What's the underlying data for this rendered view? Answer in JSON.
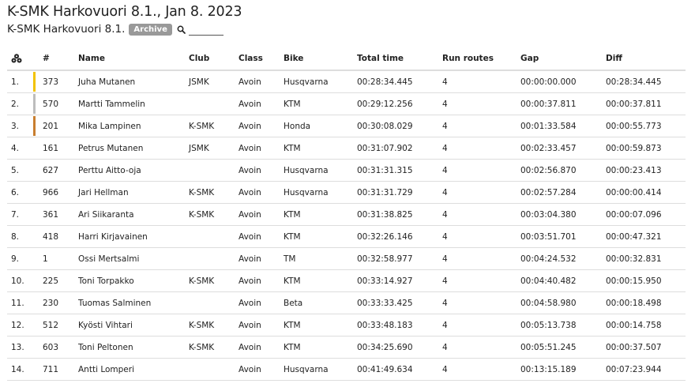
{
  "header": {
    "title": "K-SMK Harkovuori 8.1., Jan 8. 2023",
    "event_name": "K-SMK Harkovuori 8.1.",
    "badge": "Archive",
    "search_placeholder": ""
  },
  "colors": {
    "gold": "#f2c300",
    "silver": "#bdbdbd",
    "bronze": "#c87e2f",
    "badge_bg": "#999999",
    "row_border": "#dddddd"
  },
  "table": {
    "columns": {
      "num": "#",
      "name": "Name",
      "club": "Club",
      "class": "Class",
      "bike": "Bike",
      "total": "Total time",
      "runs": "Run routes",
      "gap": "Gap",
      "diff": "Diff"
    },
    "rows": [
      {
        "pos": "1.",
        "num": "373",
        "name": "Juha Mutanen",
        "club": "JSMK",
        "class": "Avoin",
        "bike": "Husqvarna",
        "total": "00:28:34.445",
        "runs": "4",
        "gap": "00:00:00.000",
        "diff": "00:28:34.445",
        "medal": "gold"
      },
      {
        "pos": "2.",
        "num": "570",
        "name": "Martti Tammelin",
        "club": "",
        "class": "Avoin",
        "bike": "KTM",
        "total": "00:29:12.256",
        "runs": "4",
        "gap": "00:00:37.811",
        "diff": "00:00:37.811",
        "medal": "silver"
      },
      {
        "pos": "3.",
        "num": "201",
        "name": "Mika Lampinen",
        "club": "K-SMK",
        "class": "Avoin",
        "bike": "Honda",
        "total": "00:30:08.029",
        "runs": "4",
        "gap": "00:01:33.584",
        "diff": "00:00:55.773",
        "medal": "bronze"
      },
      {
        "pos": "4.",
        "num": "161",
        "name": "Petrus Mutanen",
        "club": "JSMK",
        "class": "Avoin",
        "bike": "KTM",
        "total": "00:31:07.902",
        "runs": "4",
        "gap": "00:02:33.457",
        "diff": "00:00:59.873",
        "medal": ""
      },
      {
        "pos": "5.",
        "num": "627",
        "name": "Perttu Aitto-oja",
        "club": "",
        "class": "Avoin",
        "bike": "Husqvarna",
        "total": "00:31:31.315",
        "runs": "4",
        "gap": "00:02:56.870",
        "diff": "00:00:23.413",
        "medal": ""
      },
      {
        "pos": "6.",
        "num": "966",
        "name": "Jari Hellman",
        "club": "K-SMK",
        "class": "Avoin",
        "bike": "Husqvarna",
        "total": "00:31:31.729",
        "runs": "4",
        "gap": "00:02:57.284",
        "diff": "00:00:00.414",
        "medal": ""
      },
      {
        "pos": "7.",
        "num": "361",
        "name": "Ari Siikaranta",
        "club": "K-SMK",
        "class": "Avoin",
        "bike": "KTM",
        "total": "00:31:38.825",
        "runs": "4",
        "gap": "00:03:04.380",
        "diff": "00:00:07.096",
        "medal": ""
      },
      {
        "pos": "8.",
        "num": "418",
        "name": "Harri Kirjavainen",
        "club": "",
        "class": "Avoin",
        "bike": "KTM",
        "total": "00:32:26.146",
        "runs": "4",
        "gap": "00:03:51.701",
        "diff": "00:00:47.321",
        "medal": ""
      },
      {
        "pos": "9.",
        "num": "1",
        "name": "Ossi Mertsalmi",
        "club": "",
        "class": "Avoin",
        "bike": "TM",
        "total": "00:32:58.977",
        "runs": "4",
        "gap": "00:04:24.532",
        "diff": "00:00:32.831",
        "medal": ""
      },
      {
        "pos": "10.",
        "num": "225",
        "name": "Toni Torpakko",
        "club": "K-SMK",
        "class": "Avoin",
        "bike": "KTM",
        "total": "00:33:14.927",
        "runs": "4",
        "gap": "00:04:40.482",
        "diff": "00:00:15.950",
        "medal": ""
      },
      {
        "pos": "11.",
        "num": "230",
        "name": "Tuomas Salminen",
        "club": "",
        "class": "Avoin",
        "bike": "Beta",
        "total": "00:33:33.425",
        "runs": "4",
        "gap": "00:04:58.980",
        "diff": "00:00:18.498",
        "medal": ""
      },
      {
        "pos": "12.",
        "num": "512",
        "name": "Kyösti Vihtari",
        "club": "K-SMK",
        "class": "Avoin",
        "bike": "KTM",
        "total": "00:33:48.183",
        "runs": "4",
        "gap": "00:05:13.738",
        "diff": "00:00:14.758",
        "medal": ""
      },
      {
        "pos": "13.",
        "num": "603",
        "name": "Toni Peltonen",
        "club": "K-SMK",
        "class": "Avoin",
        "bike": "KTM",
        "total": "00:34:25.690",
        "runs": "4",
        "gap": "00:05:51.245",
        "diff": "00:00:37.507",
        "medal": ""
      },
      {
        "pos": "14.",
        "num": "711",
        "name": "Antti Lomperi",
        "club": "",
        "class": "Avoin",
        "bike": "Husqvarna",
        "total": "00:41:49.634",
        "runs": "4",
        "gap": "00:13:15.189",
        "diff": "00:07:23.944",
        "medal": ""
      }
    ]
  },
  "icons": {
    "position_header": "position-icon",
    "search": "search-icon"
  }
}
